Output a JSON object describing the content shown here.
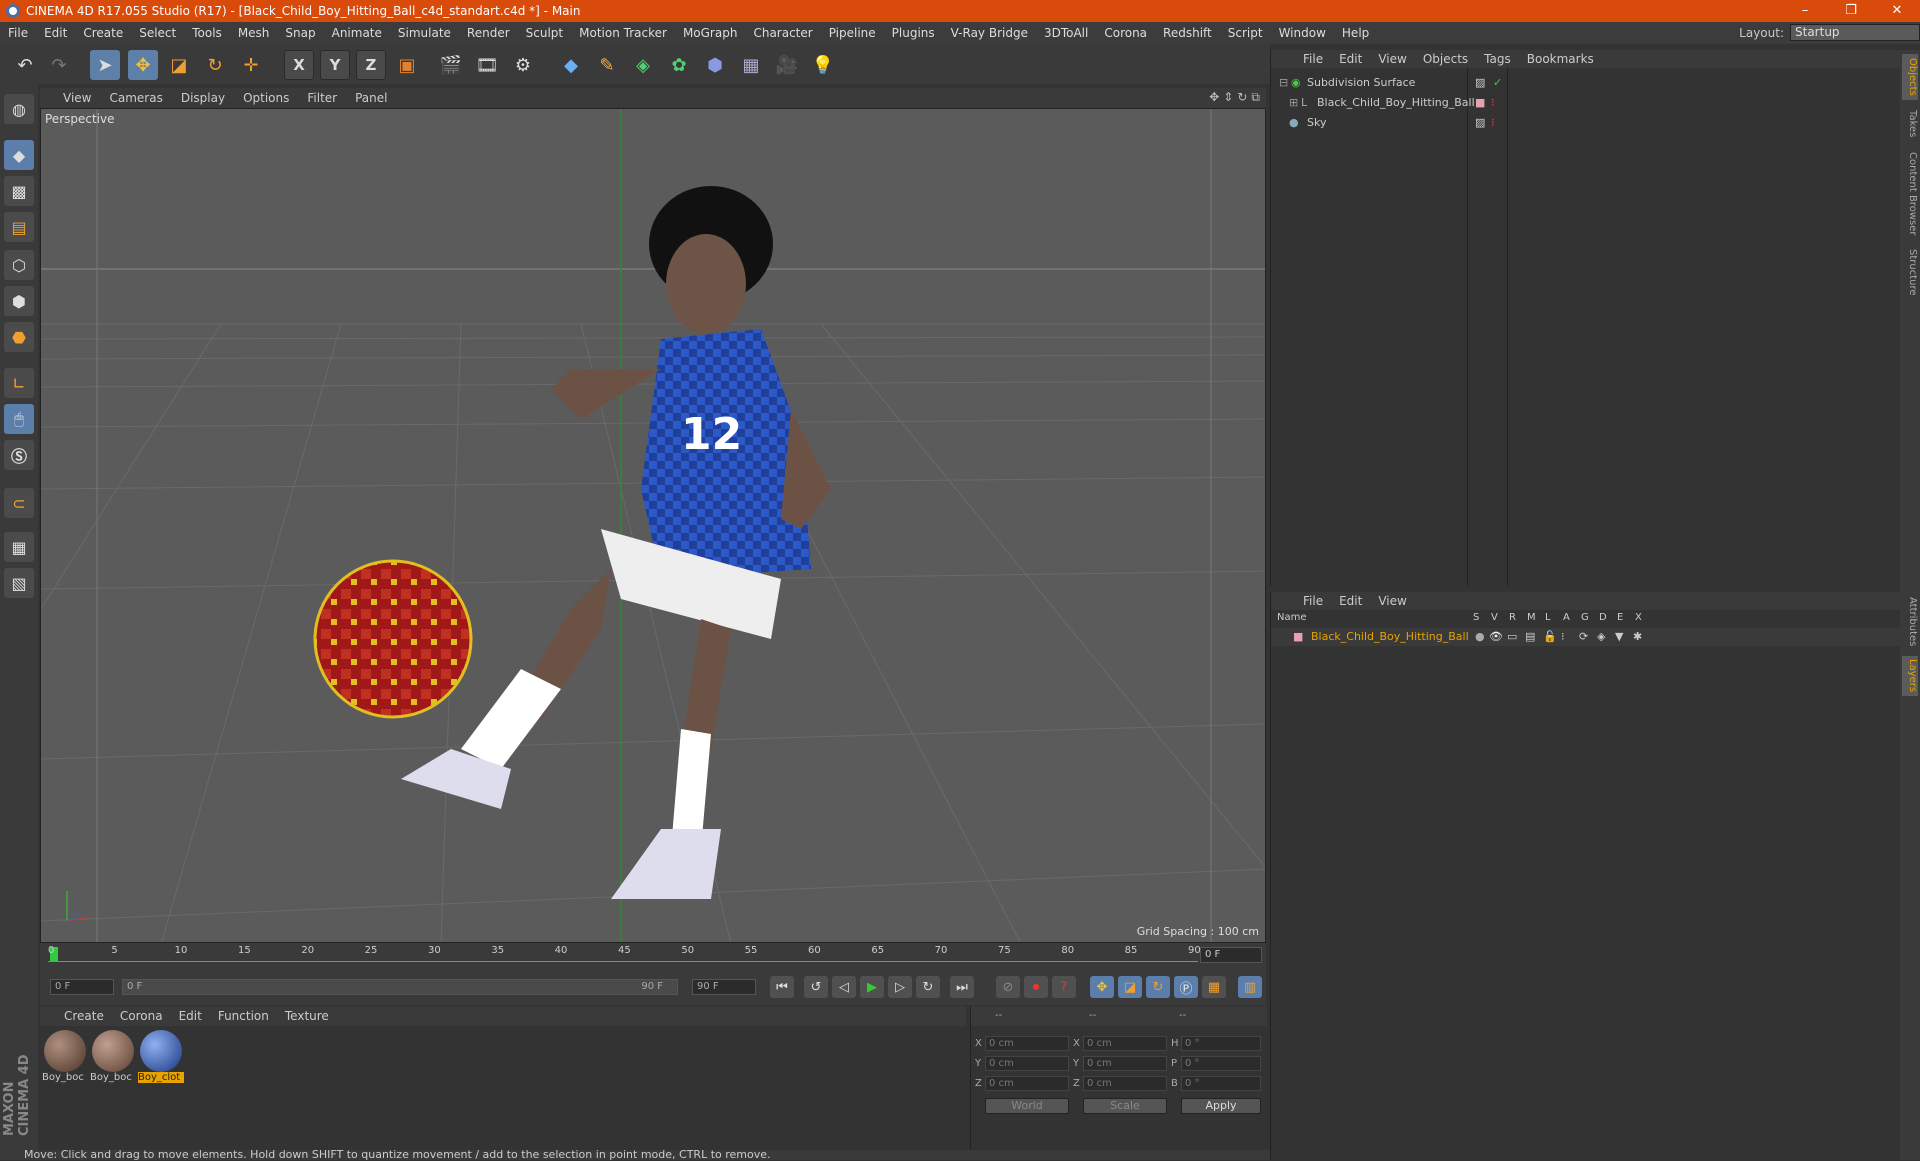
{
  "window": {
    "title": "CINEMA 4D R17.055 Studio (R17) - [Black_Child_Boy_Hitting_Ball_c4d_standart.c4d *] - Main",
    "controls": [
      "–",
      "❐",
      "✕"
    ]
  },
  "menubar": {
    "items": [
      "File",
      "Edit",
      "Create",
      "Select",
      "Tools",
      "Mesh",
      "Snap",
      "Animate",
      "Simulate",
      "Render",
      "Sculpt",
      "Motion Tracker",
      "MoGraph",
      "Character",
      "Pipeline",
      "Plugins",
      "V-Ray Bridge",
      "3DToAll",
      "Corona",
      "Redshift",
      "Script",
      "Window",
      "Help"
    ],
    "layout_label": "Layout:",
    "layout_value": "Startup"
  },
  "toolbar": {
    "axis_x": "X",
    "axis_y": "Y",
    "axis_z": "Z"
  },
  "viewport": {
    "menu": [
      "View",
      "Cameras",
      "Display",
      "Options",
      "Filter",
      "Panel"
    ],
    "label": "Perspective",
    "grid_spacing": "Grid Spacing : 100 cm"
  },
  "timeline": {
    "ticks": [
      "0",
      "5",
      "10",
      "15",
      "20",
      "25",
      "30",
      "35",
      "40",
      "45",
      "50",
      "55",
      "60",
      "65",
      "70",
      "75",
      "80",
      "85",
      "90"
    ],
    "current_frame": "0 F"
  },
  "transport": {
    "start": "0 F",
    "slider_start": "0 F",
    "slider_end": "90 F",
    "end": "90 F"
  },
  "materials": {
    "menu": [
      "Create",
      "Corona",
      "Edit",
      "Function",
      "Texture"
    ],
    "items": [
      {
        "name": "Boy_boc",
        "color": "#6b5040"
      },
      {
        "name": "Boy_boc",
        "color": "#7a5e4c"
      },
      {
        "name": "Boy_clot",
        "color": "#2a4f9a"
      }
    ]
  },
  "coords": {
    "header": [
      "--",
      "--",
      "--"
    ],
    "rows": [
      {
        "l1": "X",
        "v1": "0 cm",
        "l2": "X",
        "v2": "0 cm",
        "l3": "H",
        "v3": "0 °"
      },
      {
        "l1": "Y",
        "v1": "0 cm",
        "l2": "Y",
        "v2": "0 cm",
        "l3": "P",
        "v3": "0 °"
      },
      {
        "l1": "Z",
        "v1": "0 cm",
        "l2": "Z",
        "v2": "0 cm",
        "l3": "B",
        "v3": "0 °"
      }
    ],
    "world": "World",
    "scale": "Scale",
    "apply": "Apply"
  },
  "status": "Move: Click and drag to move elements. Hold down SHIFT to quantize movement / add to the selection in point mode, CTRL to remove.",
  "objects": {
    "menu": [
      "File",
      "Edit",
      "View",
      "Objects",
      "Tags",
      "Bookmarks"
    ],
    "items": [
      "Subdivision Surface",
      "Black_Child_Boy_Hitting_Ball",
      "Sky"
    ]
  },
  "layers": {
    "menu": [
      "File",
      "Edit",
      "View"
    ],
    "name_header": "Name",
    "cols": [
      "S",
      "V",
      "R",
      "M",
      "L",
      "A",
      "G",
      "D",
      "E",
      "X"
    ],
    "item": "Black_Child_Boy_Hitting_Ball"
  },
  "right_tabs": [
    "Objects",
    "Takes",
    "Content Browser",
    "Structure",
    "Attributes",
    "Layers"
  ],
  "brand": "MAXON CINEMA 4D"
}
